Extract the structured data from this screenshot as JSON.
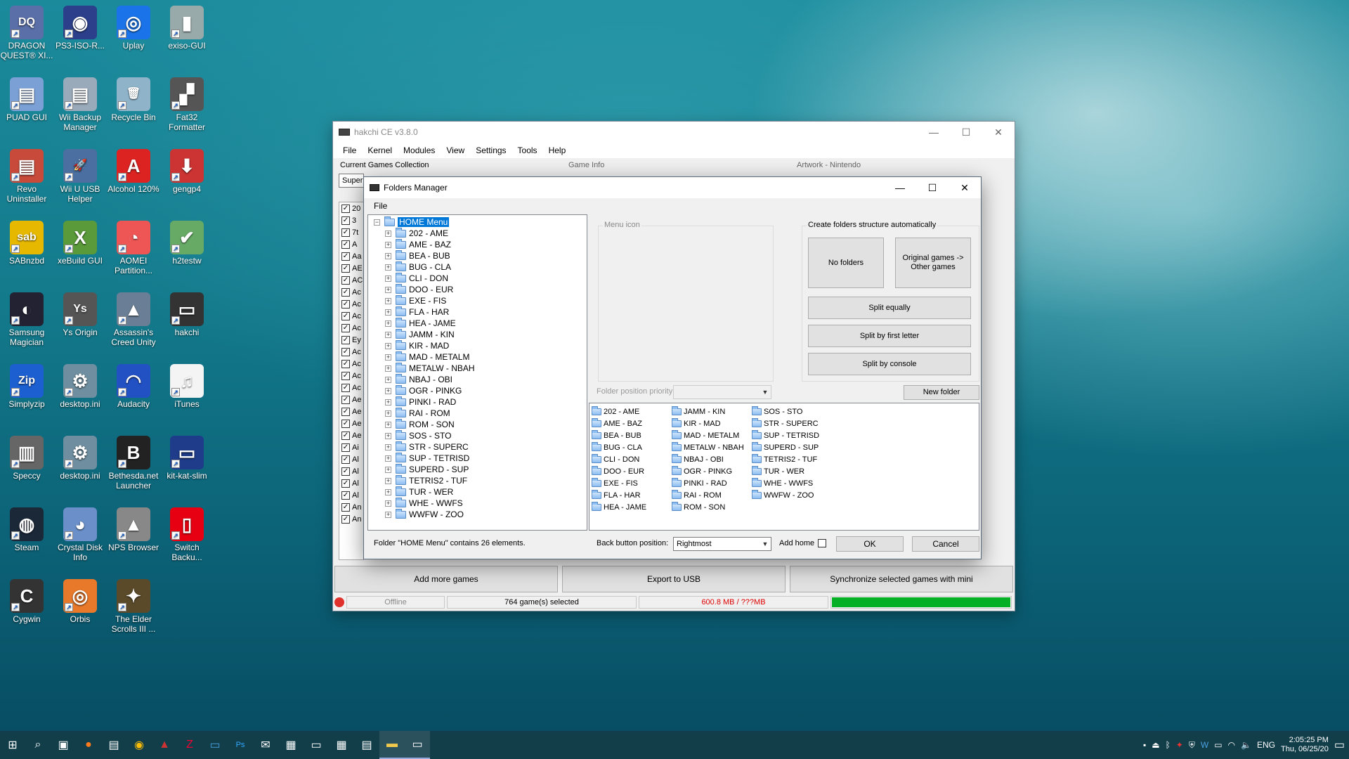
{
  "desktop_icons": [
    {
      "label": "DRAGON QUEST® XI...",
      "color": "#5a6fa8",
      "glyph": "DQ"
    },
    {
      "label": "PS3-ISO-R...",
      "color": "#2b3f8a",
      "glyph": "◉"
    },
    {
      "label": "Uplay",
      "color": "#1a73e8",
      "glyph": "◎"
    },
    {
      "label": "exiso-GUI",
      "color": "#9aa",
      "glyph": "▮"
    },
    {
      "label": "PUAD GUI",
      "color": "#7aa0d6",
      "glyph": "▤"
    },
    {
      "label": "Wii Backup Manager",
      "color": "#9ab",
      "glyph": "▤"
    },
    {
      "label": "Recycle Bin",
      "color": "#8fb3c9",
      "glyph": "🗑"
    },
    {
      "label": "Fat32 Formatter",
      "color": "#555",
      "glyph": "▞"
    },
    {
      "label": "Revo Uninstaller",
      "color": "#c74a3a",
      "glyph": "▤"
    },
    {
      "label": "Wii U USB Helper",
      "color": "#4a6fa0",
      "glyph": "🚀"
    },
    {
      "label": "Alcohol 120%",
      "color": "#d22",
      "glyph": "A"
    },
    {
      "label": "gengp4",
      "color": "#c33",
      "glyph": "⬇"
    },
    {
      "label": "SABnzbd",
      "color": "#e6b800",
      "glyph": "sab"
    },
    {
      "label": "xeBuild GUI",
      "color": "#5a9a3a",
      "glyph": "X"
    },
    {
      "label": "AOMEI Partition...",
      "color": "#e55",
      "glyph": "◔"
    },
    {
      "label": "h2testw",
      "color": "#6a6",
      "glyph": "✔"
    },
    {
      "label": "Samsung Magician",
      "color": "#223",
      "glyph": "◐"
    },
    {
      "label": "Ys Origin",
      "color": "#555",
      "glyph": "Ys"
    },
    {
      "label": "Assassin's Creed Unity",
      "color": "#6a7f95",
      "glyph": "▲"
    },
    {
      "label": "hakchi",
      "color": "#333",
      "glyph": "▭"
    },
    {
      "label": "Simplyzip",
      "color": "#1c5fd0",
      "glyph": "Zip"
    },
    {
      "label": "desktop.ini",
      "color": "#6f8fa0",
      "glyph": "⚙"
    },
    {
      "label": "Audacity",
      "color": "#2251c4",
      "glyph": "◠"
    },
    {
      "label": "iTunes",
      "color": "#f4f4f4",
      "glyph": "♫"
    },
    {
      "label": "Speccy",
      "color": "#666",
      "glyph": "▥"
    },
    {
      "label": "desktop.ini",
      "color": "#6f8fa0",
      "glyph": "⚙"
    },
    {
      "label": "Bethesda.net Launcher",
      "color": "#222",
      "glyph": "B"
    },
    {
      "label": "kit-kat-slim",
      "color": "#1f3c8a",
      "glyph": "▭"
    },
    {
      "label": "Steam",
      "color": "#1b2838",
      "glyph": "◍"
    },
    {
      "label": "Crystal Disk Info",
      "color": "#6a8fc9",
      "glyph": "◕"
    },
    {
      "label": "NPS Browser",
      "color": "#888",
      "glyph": "▲"
    },
    {
      "label": "Switch Backu...",
      "color": "#e60012",
      "glyph": "▯"
    },
    {
      "label": "Cygwin",
      "color": "#333",
      "glyph": "C"
    },
    {
      "label": "Orbis",
      "color": "#e8792a",
      "glyph": "◎"
    },
    {
      "label": "The Elder Scrolls III ...",
      "color": "#5a4a2a",
      "glyph": "✦"
    }
  ],
  "main_window": {
    "title": "hakchi CE v3.8.0",
    "menu": [
      "File",
      "Kernel",
      "Modules",
      "View",
      "Settings",
      "Tools",
      "Help"
    ],
    "current_games_label": "Current Games Collection",
    "game_info_label": "Game Info",
    "artwork_label": "Artwork - Nintendo",
    "console_combo": "Super",
    "games_list": [
      "20",
      "3",
      "7t",
      "A",
      "Aa",
      "AE",
      "AC",
      "Ac",
      "Ac",
      "Ac",
      "Ac",
      "Ey",
      "Ac",
      "Ac",
      "Ac",
      "Ac",
      "Ae",
      "Ae",
      "Ae",
      "Ae",
      "Ai",
      "Al",
      "Al",
      "Al",
      "Al",
      "An",
      "An"
    ],
    "add_more_games": "Add more games",
    "export_usb": "Export to USB",
    "sync": "Synchronize selected games with mini",
    "status": {
      "offline": "Offline",
      "selected": "764 game(s) selected",
      "size": "600.8 MB / ???MB",
      "status_color": "#e0322d",
      "progress_color": "#06b025",
      "progress_fraction": 1.0
    }
  },
  "dialog": {
    "title": "Folders Manager",
    "menu": [
      "File"
    ],
    "tree_root": "HOME Menu",
    "tree_items": [
      "202 - AME",
      "AME - BAZ",
      "BEA - BUB",
      "BUG - CLA",
      "CLI - DON",
      "DOO - EUR",
      "EXE - FIS",
      "FLA - HAR",
      "HEA - JAME",
      "JAMM - KIN",
      "KIR - MAD",
      "MAD - METALM",
      "METALW - NBAH",
      "NBAJ - OBI",
      "OGR - PINKG",
      "PINKI - RAD",
      "RAI - ROM",
      "ROM - SON",
      "SOS - STO",
      "STR - SUPERC",
      "SUP - TETRISD",
      "SUPERD - SUP",
      "TETRIS2 - TUF",
      "TUR - WER",
      "WHE - WWFS",
      "WWFW - ZOO"
    ],
    "menu_icon_label": "Menu icon",
    "create_label": "Create folders structure automatically",
    "no_folders": "No folders",
    "original_games": "Original games -> Other games",
    "split_equally": "Split equally",
    "split_first_letter": "Split by first letter",
    "split_console": "Split by console",
    "folder_position_label": "Folder position priority:",
    "new_folder": "New folder",
    "folder_columns": [
      [
        "202 - AME",
        "AME - BAZ",
        "BEA - BUB",
        "BUG - CLA",
        "CLI - DON",
        "DOO - EUR",
        "EXE - FIS",
        "FLA - HAR",
        "HEA - JAME"
      ],
      [
        "JAMM - KIN",
        "KIR - MAD",
        "MAD - METALM",
        "METALW - NBAH",
        "NBAJ - OBI",
        "OGR - PINKG",
        "PINKI - RAD",
        "RAI - ROM",
        "ROM - SON"
      ],
      [
        "SOS - STO",
        "STR - SUPERC",
        "SUP - TETRISD",
        "SUPERD - SUP",
        "TETRIS2 - TUF",
        "TUR - WER",
        "WHE - WWFS",
        "WWFW - ZOO"
      ]
    ],
    "status_text": "Folder \"HOME Menu\" contains 26 elements.",
    "back_button_label": "Back button position:",
    "back_button_value": "Rightmost",
    "add_home_label": "Add home",
    "ok": "OK",
    "cancel": "Cancel"
  },
  "taskbar": {
    "lang": "ENG",
    "time": "2:05:25 PM",
    "date": "Thu, 06/25/20"
  }
}
